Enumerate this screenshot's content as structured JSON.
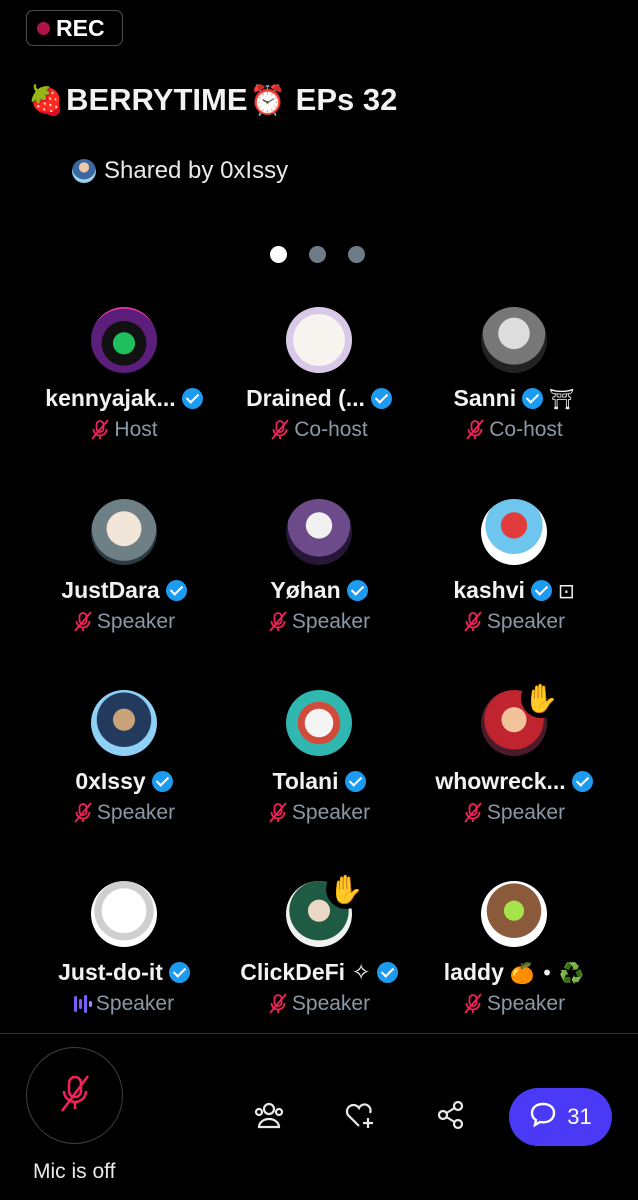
{
  "header": {
    "rec_label": "REC",
    "title_prefix_emoji": "strawberry",
    "title_text": "BERRYTIME",
    "title_suffix_emoji": "alarm-clock",
    "title_episode": "EPs 32",
    "shared_by": "Shared by 0xIssy"
  },
  "pager": {
    "pages": 3,
    "active": 0
  },
  "speakers": [
    {
      "name": "kennyajak...",
      "role": "Host",
      "verified": true,
      "extra": "",
      "muted": true,
      "raised_hand": false
    },
    {
      "name": "Drained (...",
      "role": "Co-host",
      "verified": true,
      "extra": "",
      "muted": true,
      "raised_hand": false
    },
    {
      "name": "Sanni",
      "role": "Co-host",
      "verified": true,
      "extra": "⛩",
      "muted": true,
      "raised_hand": false
    },
    {
      "name": "JustDara",
      "role": "Speaker",
      "verified": true,
      "extra": "",
      "muted": true,
      "raised_hand": false
    },
    {
      "name": "Yøhan",
      "role": "Speaker",
      "verified": true,
      "extra": "",
      "muted": true,
      "raised_hand": false
    },
    {
      "name": "kashvi",
      "role": "Speaker",
      "verified": true,
      "extra": "⊡",
      "muted": true,
      "raised_hand": false
    },
    {
      "name": "0xIssy",
      "role": "Speaker",
      "verified": true,
      "extra": "",
      "muted": true,
      "raised_hand": false
    },
    {
      "name": "Tolani",
      "role": "Speaker",
      "verified": true,
      "extra": "",
      "muted": true,
      "raised_hand": false
    },
    {
      "name": "whowreck...",
      "role": "Speaker",
      "verified": true,
      "extra": "",
      "muted": true,
      "raised_hand": true
    },
    {
      "name": "Just-do-it",
      "role": "Speaker",
      "verified": true,
      "extra": "",
      "muted": false,
      "raised_hand": false
    },
    {
      "name": "ClickDeFi ✧",
      "role": "Speaker",
      "verified": true,
      "extra": "",
      "muted": true,
      "raised_hand": true
    },
    {
      "name": "laddy",
      "role": "Speaker",
      "verified": false,
      "extra": "🍊 • ♻️",
      "muted": true,
      "raised_hand": false
    }
  ],
  "bottom_bar": {
    "mic_label": "Mic is off",
    "chat_count": "31",
    "icons": [
      "people-icon",
      "heart-plus-icon",
      "share-icon",
      "chat-bubble-icon"
    ]
  },
  "colors": {
    "background": "#000000",
    "verified": "#1d9bf0",
    "muted_icon": "#f4215a",
    "role_text": "#8b98a5",
    "chat_button": "#4a39f5",
    "rec_dot": "#b0134a"
  }
}
